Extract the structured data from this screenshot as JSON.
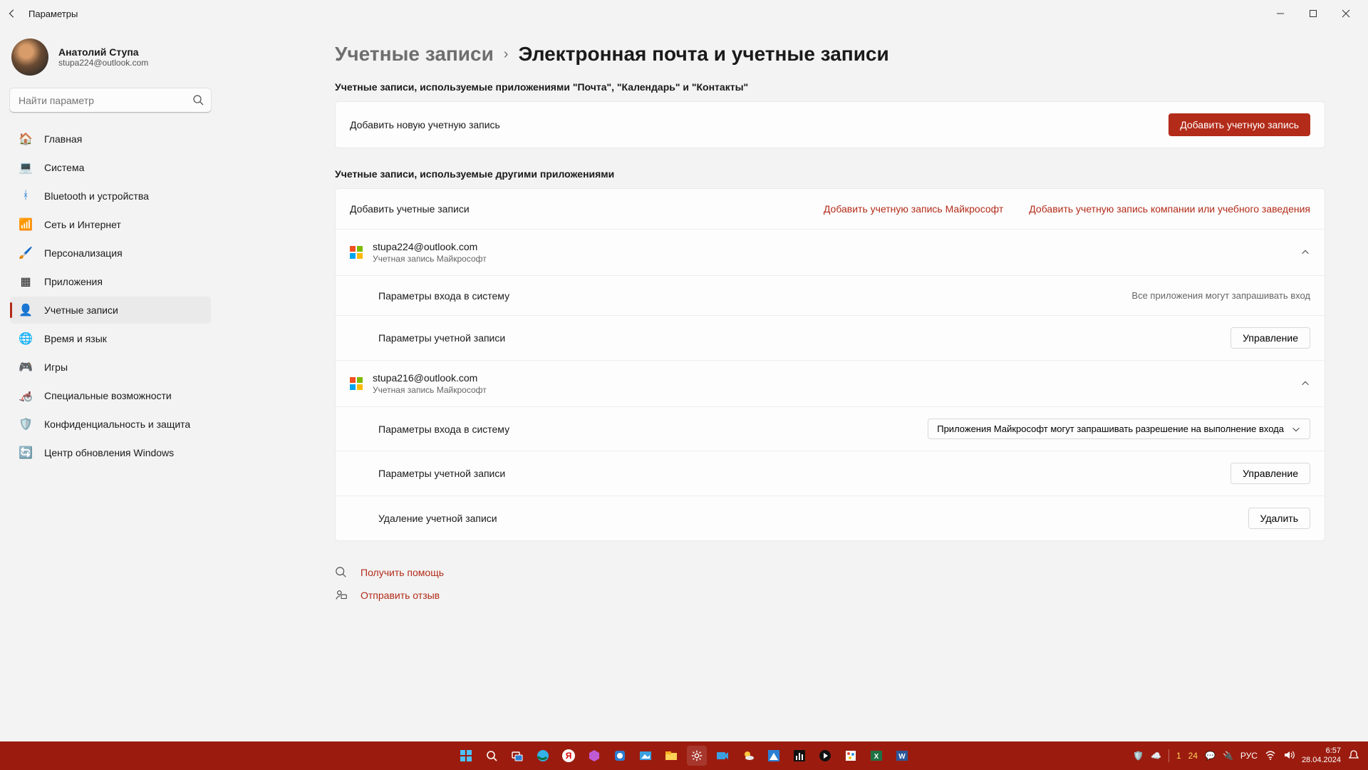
{
  "window": {
    "title": "Параметры"
  },
  "profile": {
    "name": "Анатолий Ступа",
    "email": "stupa224@outlook.com"
  },
  "search": {
    "placeholder": "Найти параметр"
  },
  "nav": {
    "items": [
      {
        "label": "Главная",
        "icon": "🏠"
      },
      {
        "label": "Система",
        "icon": "💻"
      },
      {
        "label": "Bluetooth и устройства",
        "icon": "ᚼ"
      },
      {
        "label": "Сеть и Интернет",
        "icon": "📶"
      },
      {
        "label": "Персонализация",
        "icon": "🖌️"
      },
      {
        "label": "Приложения",
        "icon": "▦"
      },
      {
        "label": "Учетные записи",
        "icon": "👤"
      },
      {
        "label": "Время и язык",
        "icon": "🌐"
      },
      {
        "label": "Игры",
        "icon": "🎮"
      },
      {
        "label": "Специальные возможности",
        "icon": "🦽"
      },
      {
        "label": "Конфиденциальность и защита",
        "icon": "🛡️"
      },
      {
        "label": "Центр обновления Windows",
        "icon": "🔄"
      }
    ],
    "activeIndex": "6"
  },
  "breadcrumb": {
    "root": "Учетные записи",
    "sep": "›",
    "leaf": "Электронная почта и учетные записи"
  },
  "section1": {
    "title": "Учетные записи, используемые приложениями \"Почта\", \"Календарь\" и \"Контакты\"",
    "add_row_label": "Добавить новую учетную запись",
    "add_btn": "Добавить учетную запись"
  },
  "section2": {
    "title": "Учетные записи, используемые другими приложениями",
    "add_row_label": "Добавить учетные записи",
    "link_ms": "Добавить учетную запись Майкрософт",
    "link_org": "Добавить учетную запись компании или учебного заведения",
    "accounts": [
      {
        "email": "stupa224@outlook.com",
        "type": "Учетная запись Майкрософт",
        "signin_label": "Параметры входа в систему",
        "signin_hint": "Все приложения могут запрашивать вход",
        "options_label": "Параметры учетной записи",
        "manage_btn": "Управление"
      },
      {
        "email": "stupa216@outlook.com",
        "type": "Учетная запись Майкрософт",
        "signin_label": "Параметры входа в систему",
        "signin_dropdown": "Приложения Майкрософт могут запрашивать разрешение на выполнение входа",
        "options_label": "Параметры учетной записи",
        "manage_btn": "Управление",
        "delete_label": "Удаление учетной записи",
        "delete_btn": "Удалить"
      }
    ]
  },
  "footer": {
    "help": "Получить помощь",
    "feedback": "Отправить отзыв"
  },
  "taskbar": {
    "tray": {
      "num1": "1",
      "num2": "24",
      "lang": "РУС"
    },
    "clock": {
      "time": "6:57",
      "date": "28.04.2024"
    }
  }
}
